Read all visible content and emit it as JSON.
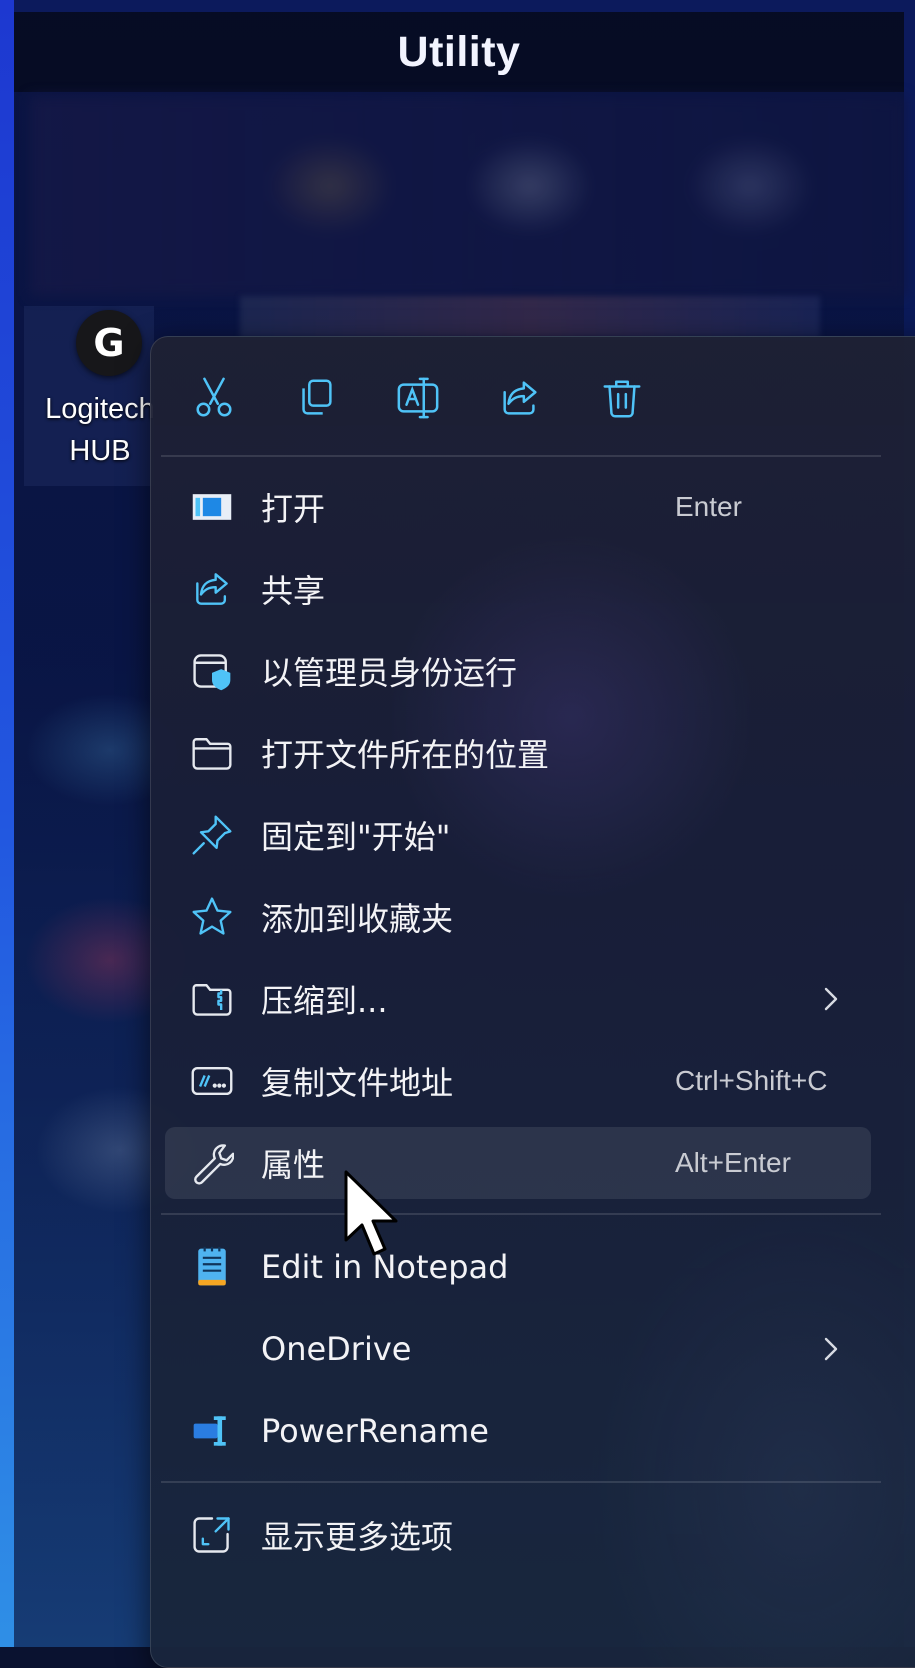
{
  "window": {
    "title": "Utility"
  },
  "desktop_icon": {
    "logo_text": "G",
    "label_line1": "Logitech",
    "label_line2": "HUB"
  },
  "toolbar": {
    "buttons": [
      {
        "name": "cut-icon",
        "tooltip": ""
      },
      {
        "name": "copy-icon",
        "tooltip": ""
      },
      {
        "name": "rename-icon",
        "tooltip": ""
      },
      {
        "name": "share-icon",
        "tooltip": ""
      },
      {
        "name": "delete-icon",
        "tooltip": ""
      }
    ]
  },
  "menu": {
    "items": [
      {
        "label": "打开",
        "shortcut": "Enter",
        "icon": "app-window-icon"
      },
      {
        "label": "共享",
        "shortcut": "",
        "icon": "share-icon"
      },
      {
        "label": "以管理员身份运行",
        "shortcut": "",
        "icon": "admin-shield-icon"
      },
      {
        "label": "打开文件所在的位置",
        "shortcut": "",
        "icon": "folder-icon"
      },
      {
        "label": "固定到\"开始\"",
        "shortcut": "",
        "icon": "pin-icon"
      },
      {
        "label": "添加到收藏夹",
        "shortcut": "",
        "icon": "star-icon"
      },
      {
        "label": "压缩到...",
        "shortcut": "",
        "icon": "zip-folder-icon",
        "submenu": true
      },
      {
        "label": "复制文件地址",
        "shortcut": "Ctrl+Shift+C",
        "icon": "copy-path-icon"
      },
      {
        "label": "属性",
        "shortcut": "Alt+Enter",
        "icon": "wrench-icon",
        "hovered": true
      }
    ],
    "extensions": [
      {
        "label": "Edit in Notepad",
        "icon": "notepad-icon"
      },
      {
        "label": "OneDrive",
        "icon": "",
        "submenu": true
      },
      {
        "label": "PowerRename",
        "icon": "powerrename-icon"
      }
    ],
    "more": {
      "label": "显示更多选项",
      "icon": "show-more-icon"
    }
  },
  "colors": {
    "accent": "#4fc3f7",
    "menu_text": "#f3f3f6",
    "shortcut_text": "#c9cbd2"
  }
}
